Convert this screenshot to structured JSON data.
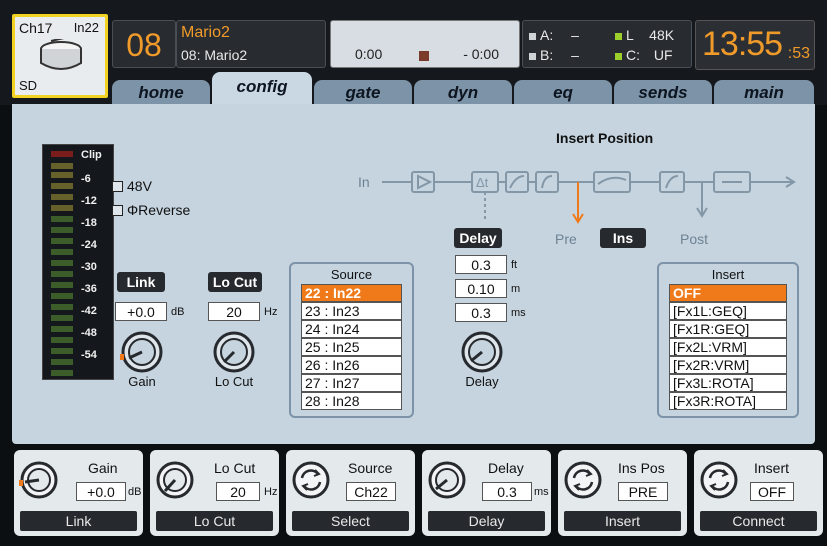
{
  "channel": {
    "id": "Ch17",
    "input": "In22",
    "source_type": "SD",
    "number": "08",
    "name": "Mario2",
    "full_name": "08: Mario2"
  },
  "transport": {
    "elapsed": "0:00",
    "remaining": "- 0:00"
  },
  "io": {
    "a_label": "A:",
    "a_value": "–",
    "b_label": "B:",
    "b_value": "–",
    "l_label": "L",
    "l_value": "48K",
    "c_label": "C:",
    "c_value": "UF"
  },
  "clock": {
    "time": "13:55",
    "seconds": ":53"
  },
  "tabs": [
    {
      "label": "home"
    },
    {
      "label": "config"
    },
    {
      "label": "gate"
    },
    {
      "label": "dyn"
    },
    {
      "label": "eq"
    },
    {
      "label": "sends"
    },
    {
      "label": "main"
    }
  ],
  "meter": {
    "labels": [
      "Clip",
      "-6",
      "-12",
      "-18",
      "-24",
      "-30",
      "-36",
      "-42",
      "-48",
      "-54"
    ]
  },
  "config": {
    "phantom_label": "48V",
    "reverse_label": "ΦReverse",
    "link": {
      "label": "Link",
      "value": "+0.0",
      "unit": "dB",
      "knob_label": "Gain"
    },
    "locut": {
      "label": "Lo Cut",
      "value": "20",
      "unit": "Hz",
      "knob_label": "Lo Cut"
    },
    "source": {
      "title": "Source",
      "items": [
        "22 : In22",
        "23 : In23",
        "24 : In24",
        "25 : In25",
        "26 : In26",
        "27 : In27",
        "28 : In28"
      ]
    },
    "delay": {
      "label": "Delay",
      "ft": "0.3",
      "ft_unit": "ft",
      "m": "0.10",
      "m_unit": "m",
      "ms": "0.3",
      "ms_unit": "ms",
      "knob_label": "Delay"
    },
    "insert_position": {
      "title": "Insert Position",
      "in_label": "In",
      "pre_label": "Pre",
      "ins_label": "Ins",
      "post_label": "Post",
      "dt_label": "Δt"
    },
    "insert": {
      "title": "Insert",
      "items": [
        "OFF",
        "[Fx1L:GEQ]",
        "[Fx1R:GEQ]",
        "[Fx2L:VRM]",
        "[Fx2R:VRM]",
        "[Fx3L:ROTA]",
        "[Fx3R:ROTA]"
      ]
    }
  },
  "encoders": [
    {
      "title": "Gain",
      "value": "+0.0",
      "unit": "dB",
      "button": "Link",
      "icon": "knob-icon"
    },
    {
      "title": "Lo Cut",
      "value": "20",
      "unit": "Hz",
      "button": "Lo Cut",
      "icon": "knob-icon"
    },
    {
      "title": "Source",
      "value": "Ch22",
      "unit": "",
      "button": "Select",
      "icon": "rotate-icon"
    },
    {
      "title": "Delay",
      "value": "0.3",
      "unit": "ms",
      "button": "Delay",
      "icon": "knob-icon"
    },
    {
      "title": "Ins Pos",
      "value": "PRE",
      "unit": "",
      "button": "Insert",
      "icon": "rotate-icon"
    },
    {
      "title": "Insert",
      "value": "OFF",
      "unit": "",
      "button": "Connect",
      "icon": "rotate-icon"
    }
  ],
  "colors": {
    "accent": "#f09a2a",
    "selection": "#f07a1a",
    "panel": "#c5d4df",
    "tab": "#7d93a7",
    "highlight": "#f1d223"
  }
}
